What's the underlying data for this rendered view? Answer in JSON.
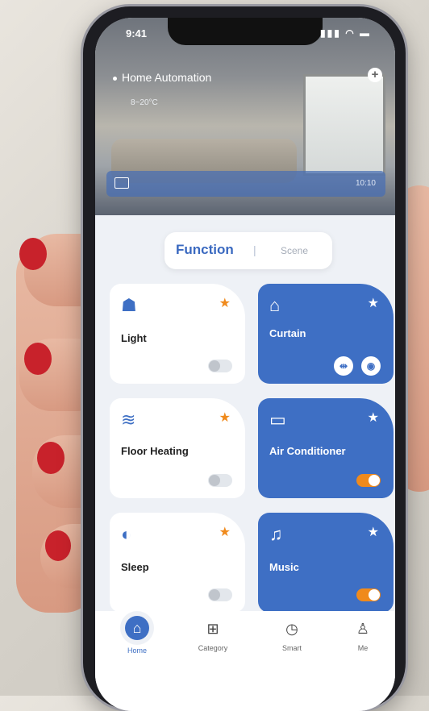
{
  "status": {
    "time": "9:41",
    "icons": "▮▮▮ ◠ ▬"
  },
  "hero": {
    "title": "Home Automation",
    "weather": {
      "left": "",
      "temp": "8~20°C",
      "humidity": "",
      "pm": ""
    },
    "message": {
      "text": "",
      "time": "10:10"
    }
  },
  "segment": {
    "function": "Function",
    "separator": "|",
    "scene": "Scene"
  },
  "cards": [
    {
      "name": "Light",
      "icon": "☗",
      "sub1": "",
      "sub2": "",
      "color": "white",
      "toggle": "off"
    },
    {
      "name": "Curtain",
      "icon": "⌂",
      "sub1": "",
      "sub2": "",
      "color": "blue"
    },
    {
      "name": "Floor Heating",
      "icon": "≋",
      "sub1": "",
      "sub2": "",
      "color": "white",
      "toggle": "off"
    },
    {
      "name": "Air Conditioner",
      "icon": "▭",
      "sub1": "",
      "sub2": "",
      "color": "blue",
      "toggle": "on"
    },
    {
      "name": "Sleep",
      "icon": "◐",
      "sub1": "",
      "sub2": "",
      "color": "white",
      "toggle": "off"
    },
    {
      "name": "Music",
      "icon": "♫",
      "sub1": "",
      "sub2": "",
      "color": "blue",
      "toggle": "on"
    }
  ],
  "star_glyph": "★",
  "curtain_buttons": {
    "left": "⇹",
    "right": "◉"
  },
  "tabs": [
    {
      "label": "Home",
      "icon": "⌂"
    },
    {
      "label": "Category",
      "icon": "⊞"
    },
    {
      "label": "Smart",
      "icon": "◷"
    },
    {
      "label": "Me",
      "icon": "♙"
    }
  ],
  "colors": {
    "accent": "#3e6fc4",
    "star": "#f08a1c",
    "toggle_on": "#f08a1c"
  }
}
